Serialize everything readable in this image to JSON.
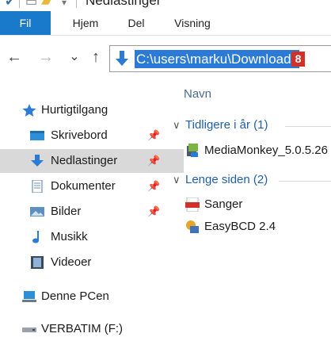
{
  "window": {
    "title": "Nedlastinger"
  },
  "ribbon": {
    "tabs": [
      "Fil",
      "Hjem",
      "Del",
      "Visning"
    ]
  },
  "nav": {
    "back": "←",
    "forward": "→",
    "recent": "⌄",
    "up": "↑"
  },
  "address": {
    "path": "C:\\users\\marku\\Downloads",
    "badge": "8"
  },
  "sidebar": {
    "quick_access": "Hurtigtilgang",
    "items": [
      {
        "label": "Skrivebord",
        "pinned": true
      },
      {
        "label": "Nedlastinger",
        "pinned": true,
        "selected": true
      },
      {
        "label": "Dokumenter",
        "pinned": true
      },
      {
        "label": "Bilder",
        "pinned": true
      },
      {
        "label": "Musikk",
        "pinned": false
      },
      {
        "label": "Videoer",
        "pinned": false
      }
    ],
    "this_pc": "Denne PCen",
    "drive": "VERBATIM (F:)"
  },
  "content": {
    "column_header": "Navn",
    "groups": [
      {
        "label": "Tidligere i år (1)",
        "files": [
          {
            "name": "MediaMonkey_5.0.5.26",
            "icon": "installer-icon"
          }
        ]
      },
      {
        "label": "Lenge siden (2)",
        "files": [
          {
            "name": "Sanger",
            "icon": "pdf-icon"
          },
          {
            "name": "EasyBCD 2.4",
            "icon": "app-icon"
          }
        ]
      }
    ]
  },
  "colors": {
    "accent": "#1979ca",
    "selection": "#2b7bd6",
    "badge": "#d0322a",
    "group_text": "#1f5fa8"
  }
}
